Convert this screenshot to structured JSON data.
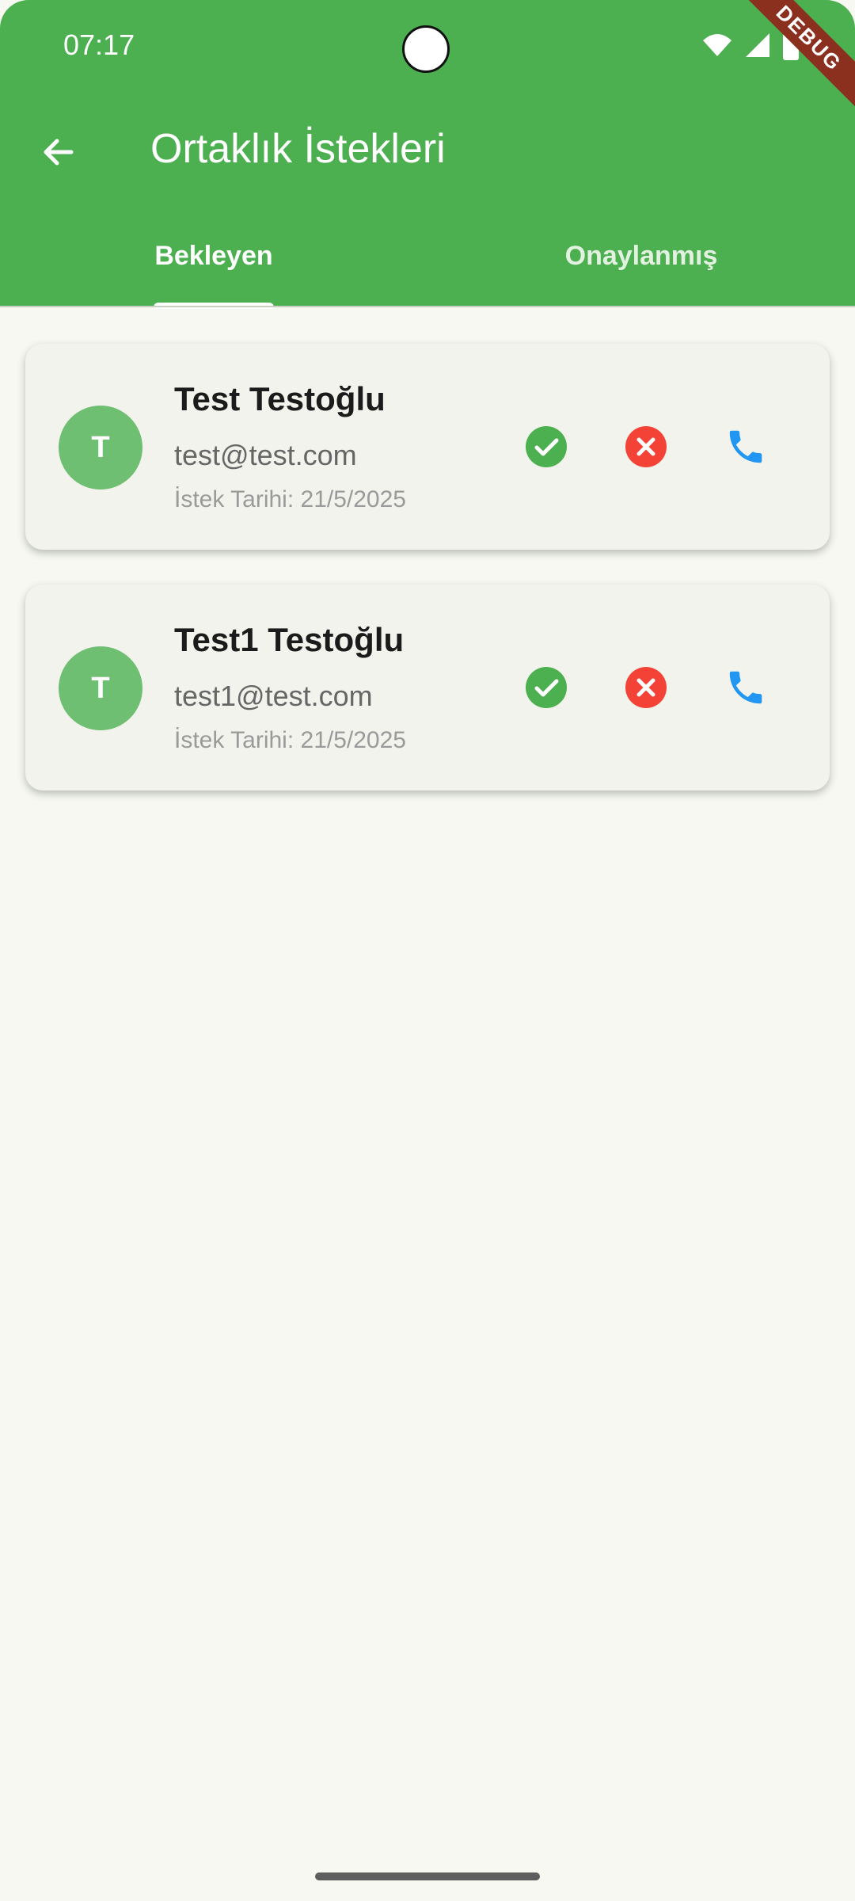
{
  "status_bar": {
    "time": "07:17"
  },
  "header": {
    "title": "Ortaklık İstekleri"
  },
  "tabs": [
    {
      "label": "Bekleyen",
      "active": true
    },
    {
      "label": "Onaylanmış",
      "active": false
    }
  ],
  "requests": [
    {
      "initial": "T",
      "name": "Test Testoğlu",
      "email": "test@test.com",
      "date": "İstek Tarihi: 21/5/2025"
    },
    {
      "initial": "T",
      "name": "Test1 Testoğlu",
      "email": "test1@test.com",
      "date": "İstek Tarihi: 21/5/2025"
    }
  ],
  "debug_banner": "DEBUG",
  "colors": {
    "appbar": "#4caf50",
    "approve": "#4caf50",
    "reject": "#f44336",
    "call": "#2196f3",
    "avatar": "#6fbf73"
  }
}
